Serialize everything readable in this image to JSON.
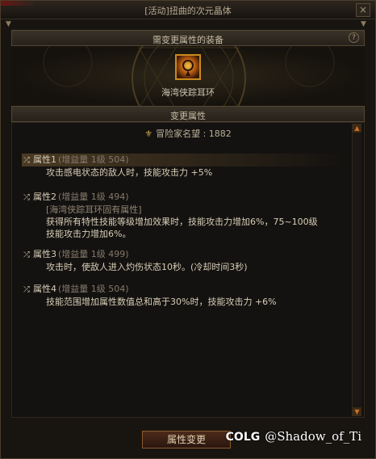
{
  "window": {
    "title": "[活动]扭曲的次元晶体",
    "close_icon": "×"
  },
  "header": {
    "title": "需变更属性的装备",
    "help_icon": "?"
  },
  "equipment": {
    "name": "海湾侠踪耳环",
    "icon": "earring-icon",
    "border_color": "#c98a1e"
  },
  "section": {
    "title": "变更属性"
  },
  "fame": {
    "icon": "fame-icon",
    "label": "冒险家名望 : 1882"
  },
  "attributes": [
    {
      "name": "属性1",
      "info": "(增益量 1级 504)",
      "lines": [
        "攻击感电状态的敌人时，技能攻击力 +5%"
      ]
    },
    {
      "name": "属性2",
      "info": "(增益量 1级 494)",
      "fixed": "[海湾侠踪耳环固有属性]",
      "lines": [
        "获得所有特性技能等级增加效果时，技能攻击力增加6%，75~100级",
        "技能攻击力增加6%。"
      ]
    },
    {
      "name": "属性3",
      "info": "(增益量 1级 499)",
      "lines": [
        "攻击时，使敌人进入灼伤状态10秒。(冷却时间3秒)"
      ]
    },
    {
      "name": "属性4",
      "info": "(增益量 1级 504)",
      "lines": [
        "技能范围增加属性数值总和高于30%时，技能攻击力 +6%"
      ]
    }
  ],
  "footer": {
    "change_button": "属性变更",
    "watermark_logo": "COLG",
    "watermark_user": "@Shadow_of_Ti"
  },
  "colors": {
    "accent": "#c98a1e",
    "scroll_arrow": "#d07020"
  }
}
